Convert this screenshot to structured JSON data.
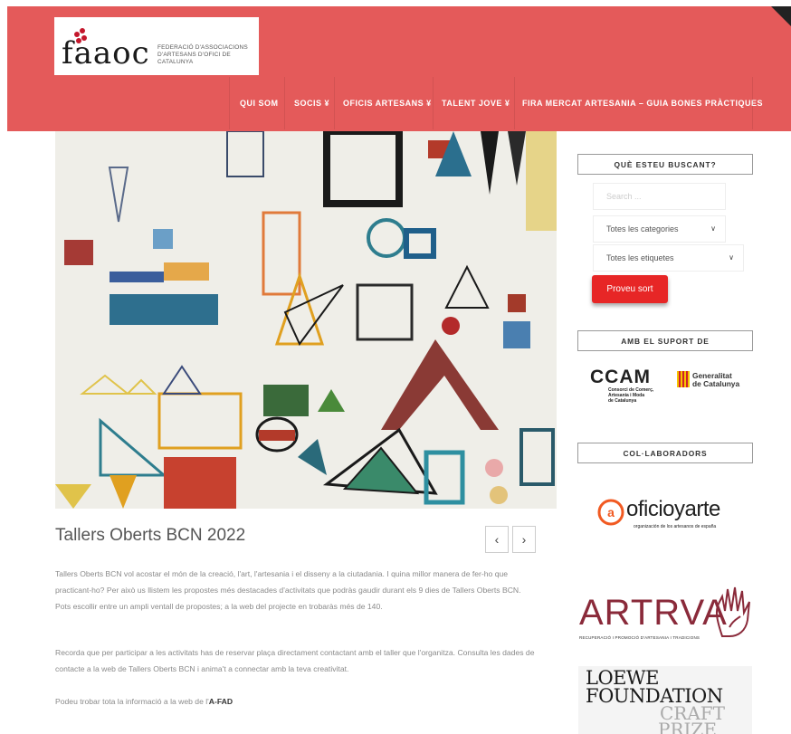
{
  "brand": {
    "logo_text": "faaoc",
    "tagline_line1": "FEDERACIÓ D'ASSOCIACIONS",
    "tagline_line2": "D'ARTESANS D'OFICI DE CATALUNYA"
  },
  "nav": {
    "items": [
      {
        "label": "QUI SOM"
      },
      {
        "label": "SOCIS ¥"
      },
      {
        "label": "OFICIS ARTESANS ¥"
      },
      {
        "label": "TALENT JOVE ¥"
      },
      {
        "label": "FIRA MERCAT ARTESANIA – GUIA BONES PRÀCTIQUES"
      }
    ]
  },
  "post": {
    "title": "Tallers Oberts BCN 2022",
    "prev_icon": "chevron-left-icon",
    "next_icon": "chevron-right-icon",
    "paragraphs": [
      "Tallers Oberts BCN vol acostar el món de la creació, l'art, l'artesania i el disseny a la ciutadania. I quina millor manera de fer-ho que practicant-ho? Per això us llistem les propostes més destacades d'activitats que podràs gaudir durant els 9 dies de Tallers Oberts BCN. Pots escollir entre un ampli ventall de propostes; a la web del projecte en trobaràs més de 140.",
      "Recorda que per participar a les activitats has de reservar plaça directament contactant amb el taller que l'organitza. Consulta les dades de contacte a la web de Tallers Oberts BCN i anima't a connectar amb la teva creativitat."
    ],
    "last_para_text": "Podeu trobar tota la informació a la web de l'",
    "last_para_link": "A-FAD"
  },
  "sidebar": {
    "search": {
      "title": "QUÈ ESTEU BUSCANT?",
      "placeholder": "Search ...",
      "category_select": "Totes les categories",
      "tag_select": "Totes les etiquetes",
      "button": "Proveu sort"
    },
    "support": {
      "title": "AMB EL SUPORT DE",
      "ccam_logo": "CCAM",
      "ccam_sub1": "Consorci de Comerç,",
      "ccam_sub2": "Artesania i Moda",
      "ccam_sub3": "de Catalunya",
      "gencat_line1": "Generalitat",
      "gencat_line2": "de Catalunya"
    },
    "collaborators": {
      "title": "COL·LABORADORS",
      "oficioyarte": "oficioyarte",
      "oficioyarte_sub": "organización de los artesanos de españa",
      "artrva": "ARTRVA",
      "artrva_sub": "RECUPERACIÓ I PROMOCIÓ D'ARTESANIA I TRADICIONS",
      "loewe_line1": "LOEWE",
      "loewe_line2": "FOUNDATION",
      "loewe_line3": "CRAFT",
      "loewe_line4": "PRIZE"
    }
  },
  "colors": {
    "header_bg": "#e45a5a",
    "button_bg": "#e72626",
    "oficio_orange": "#f15a22",
    "artrva_maroon": "#8a2a3a"
  }
}
